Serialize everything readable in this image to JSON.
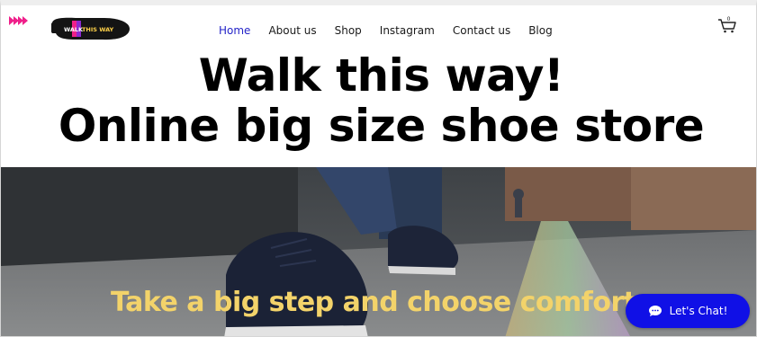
{
  "header": {
    "logo_text_left": "WALK",
    "logo_text_right": "THIS WAY",
    "nav": [
      {
        "label": "Home",
        "active": true
      },
      {
        "label": "About us",
        "active": false
      },
      {
        "label": "Shop",
        "active": false
      },
      {
        "label": "Instagram",
        "active": false
      },
      {
        "label": "Contact us",
        "active": false
      },
      {
        "label": "Blog",
        "active": false
      }
    ],
    "cart_count": "0"
  },
  "hero": {
    "headline_line1": "Walk this way!",
    "headline_line2": "Online big size shoe store",
    "tagline": "Take a big step and choose comfort"
  },
  "chat": {
    "label": "Let's Chat!"
  },
  "colors": {
    "accent_pink": "#ef1f8a",
    "nav_active": "#2424c8",
    "tagline": "#f3d36a",
    "chat_button": "#1010e6"
  },
  "icons": [
    "menu-arrows-icon",
    "cart-icon",
    "chat-bubble-icon"
  ]
}
